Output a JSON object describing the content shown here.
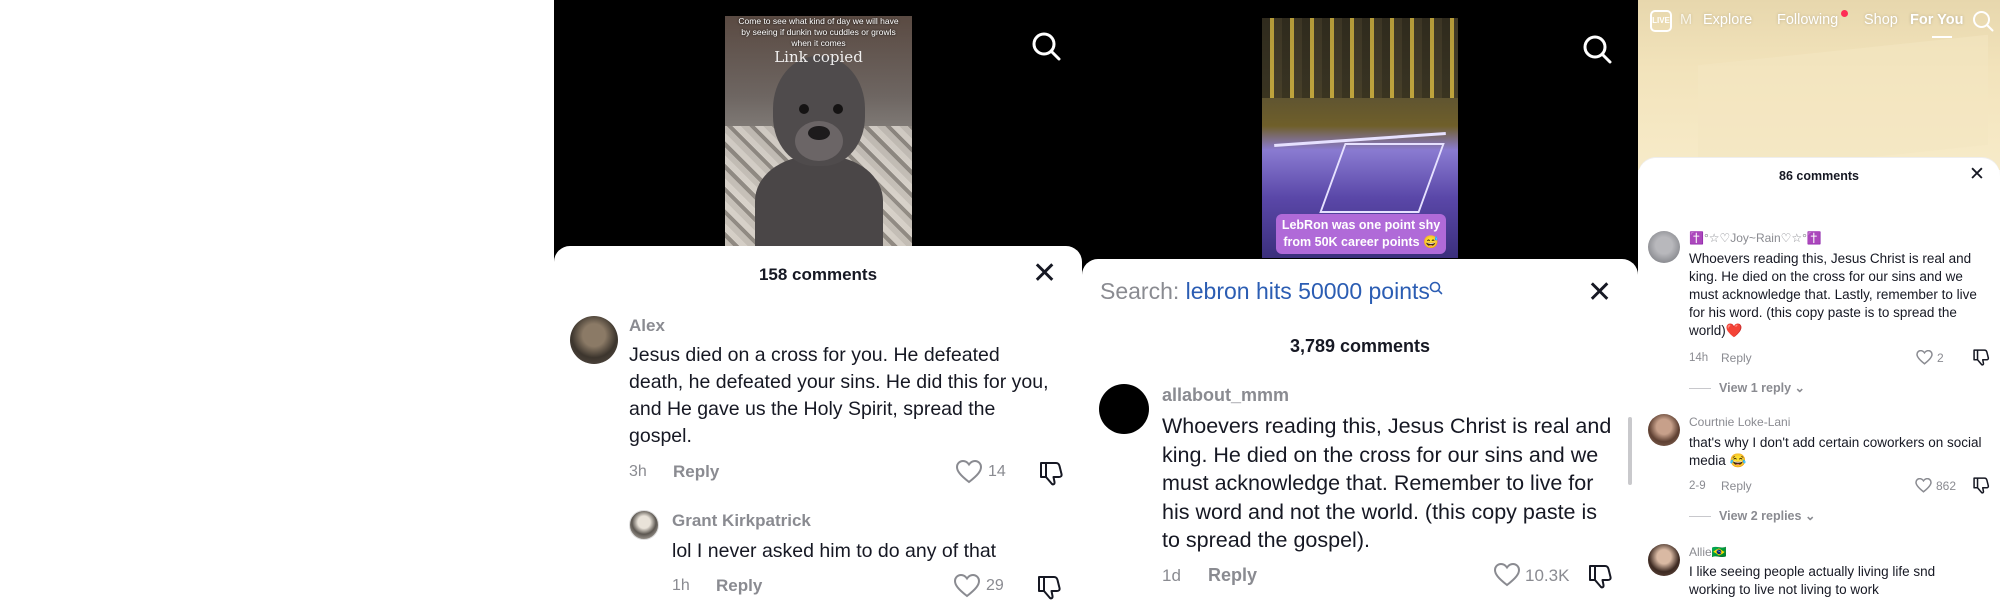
{
  "panel1": {
    "video": {
      "caption_small": "Come to see what kind of day we will have by seeing if dunkin two cuddles or growls when it comes",
      "caption_big": "Link copied"
    },
    "comments_header": "158 comments",
    "comments": [
      {
        "user": "Alex",
        "text": "Jesus died on a cross for you. He defeated death, he defeated your sins. He did this for you, and He gave us the Holy Spirit, spread the gospel.",
        "time": "3h",
        "reply": "Reply",
        "likes": "14"
      },
      {
        "user": "Grant Kirkpatrick",
        "text": "lol I never asked him to do any of that",
        "time": "1h",
        "reply": "Reply",
        "likes": "29"
      }
    ]
  },
  "panel2": {
    "video": {
      "caption": "LebRon was one point shy from 50K career points 😅"
    },
    "search": {
      "label": "Search:",
      "query": "lebron hits 50000 points"
    },
    "comments_header": "3,789 comments",
    "comments": [
      {
        "user": "allabout_mmm",
        "text": "Whoevers reading this, Jesus Christ is real and king. He died on the cross for our sins and we must acknowledge that. Remember to live for his word and not the world. (this copy paste is to spread the gospel).",
        "time": "1d",
        "reply": "Reply",
        "likes": "10.3K"
      }
    ]
  },
  "panel3": {
    "nav": {
      "live": "LIVE",
      "partial": "M",
      "items": [
        "Explore",
        "Following",
        "Shop",
        "For You"
      ]
    },
    "comments_header": "86 comments",
    "comments": [
      {
        "user": "✝️°☆♡Joy~Rain♡☆°✝️",
        "text": "Whoevers reading this, Jesus Christ is real and king. He died on the cross for our sins and we must acknowledge that. Lastly, remember to live for his word. (this copy paste is to spread the world)❤️",
        "time": "14h",
        "reply": "Reply",
        "likes": "2",
        "view_replies": "View 1 reply"
      },
      {
        "user": "Courtnie Loke-Lani",
        "text": "that's why I don't add certain coworkers on social media 😂",
        "time": "2-9",
        "reply": "Reply",
        "likes": "862",
        "view_replies": "View 2 replies"
      },
      {
        "user": "Allie🇧🇷",
        "text": "I like seeing people actually living life snd working to live not living to work"
      }
    ]
  },
  "colors": {
    "text": "#161823",
    "muted": "#8a8b91",
    "search_query": "#2b5db3",
    "notification_dot": "#fe2c55"
  }
}
